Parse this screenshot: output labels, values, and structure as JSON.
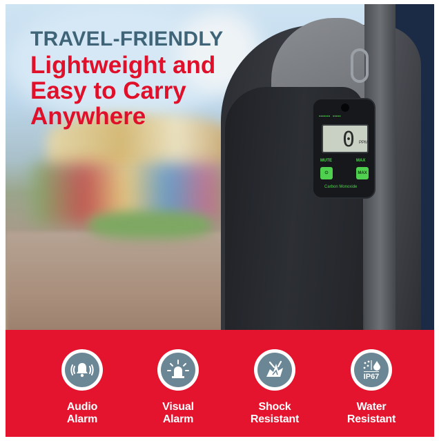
{
  "headline": {
    "eyebrow": "TRAVEL-FRIENDLY",
    "line1": "Lightweight and",
    "line2": "Easy to Carry",
    "line3": "Anywhere"
  },
  "device": {
    "reading": "0",
    "unit": "PPM",
    "label_mute": "MUTE",
    "label_max": "MAX",
    "button_left": "⏻",
    "button_right": "MAX",
    "name": "Carbon Monoxide"
  },
  "features": [
    {
      "line1": "Audio",
      "line2": "Alarm",
      "icon": "audio-alarm-icon"
    },
    {
      "line1": "Visual",
      "line2": "Alarm",
      "icon": "visual-alarm-icon"
    },
    {
      "line1": "Shock",
      "line2": "Resistant",
      "icon": "shock-resistant-icon"
    },
    {
      "line1": "Water",
      "line2": "Resistant",
      "icon": "water-resistant-icon",
      "badge": "IP67"
    }
  ],
  "colors": {
    "accent_red": "#e4142e",
    "headline_blue": "#3f6478",
    "icon_grey": "#6b8796",
    "device_green": "#4fd14f"
  }
}
